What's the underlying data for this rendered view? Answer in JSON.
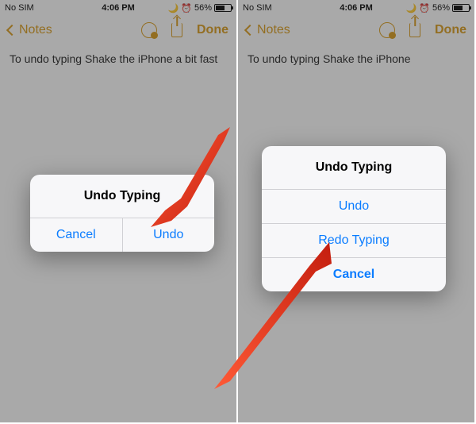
{
  "colors": {
    "accent": "#d99a18",
    "link_blue": "#0a7cff",
    "arrow": "#e23a1a"
  },
  "left": {
    "status": {
      "carrier": "No SIM",
      "time": "4:06 PM",
      "battery_pct": "56%",
      "dnd_icon": "🌙",
      "alarm_icon": "⏰"
    },
    "nav": {
      "back_label": "Notes",
      "done_label": "Done"
    },
    "note_text": "To undo typing Shake the iPhone a bit fast",
    "dialog": {
      "title": "Undo Typing",
      "cancel": "Cancel",
      "undo": "Undo"
    }
  },
  "right": {
    "status": {
      "carrier": "No SIM",
      "time": "4:06 PM",
      "battery_pct": "56%",
      "dnd_icon": "🌙",
      "alarm_icon": "⏰"
    },
    "nav": {
      "back_label": "Notes",
      "done_label": "Done"
    },
    "note_text": "To undo typing Shake the iPhone",
    "dialog": {
      "title": "Undo Typing",
      "undo": "Undo",
      "redo": "Redo Typing",
      "cancel": "Cancel"
    }
  }
}
